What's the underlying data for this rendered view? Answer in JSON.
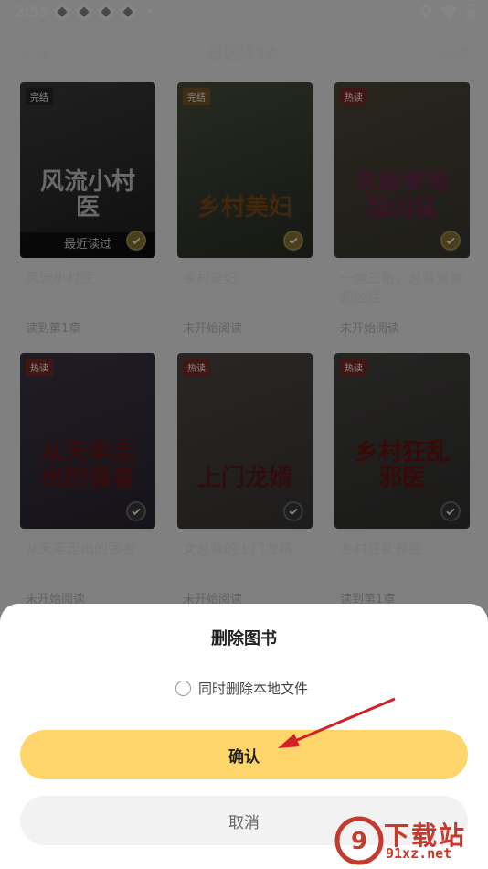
{
  "status": {
    "time": "2:55"
  },
  "header": {
    "select_all": "全选",
    "title": "已选择3本",
    "done": "完成"
  },
  "books": [
    {
      "tag": "完结",
      "cover_title": "风流小村医",
      "recent": "最近读过",
      "name": "风流小村医",
      "progress": "读到第1章",
      "bg1": "#3d3d3d",
      "bg2": "#1f1f1f",
      "tagcolor": "#2a2a2a",
      "titlecolor": "#c9c9c9",
      "check": "gold"
    },
    {
      "tag": "完结",
      "cover_title": "乡村美妇",
      "recent": "",
      "name": "乡村美妇",
      "progress": "未开始阅读",
      "bg1": "#4b5140",
      "bg2": "#2b3126",
      "tagcolor": "#7a5a2a",
      "titlecolor": "#7b4c19",
      "check": "gold"
    },
    {
      "tag": "热读",
      "cover_title": "总裁爹地超凶猛",
      "recent": "",
      "name": "一胞三胎，总裁爹爹超凶猛",
      "progress": "未开始阅读",
      "bg1": "#4d4838",
      "bg2": "#3b3a30",
      "tagcolor": "#7a2e2a",
      "titlecolor": "#6b2a4a",
      "check": "gold"
    },
    {
      "tag": "热读",
      "cover_title": "从天牢走出的强者",
      "recent": "",
      "name": "从天牢走出的强者",
      "progress": "未开始阅读",
      "bg1": "#3f3747",
      "bg2": "#2a2530",
      "tagcolor": "#7a2e2a",
      "titlecolor": "#6a1818",
      "check": "dark"
    },
    {
      "tag": "热读",
      "cover_title": "上门龙婿",
      "recent": "",
      "name": "女总裁的上门龙婿",
      "progress": "未开始阅读",
      "bg1": "#4f4a47",
      "bg2": "#3b3735",
      "tagcolor": "#7a2e2a",
      "titlecolor": "#5a1a1a",
      "check": "dark"
    },
    {
      "tag": "热读",
      "cover_title": "乡村狂乱邪医",
      "recent": "",
      "name": "乡村狂乱邪医",
      "progress": "读到第1章",
      "bg1": "#474644",
      "bg2": "#333230",
      "tagcolor": "#7a2e2a",
      "titlecolor": "#6a1515",
      "check": "dark"
    }
  ],
  "dialog": {
    "title": "删除图书",
    "option": "同时删除本地文件",
    "confirm": "确认",
    "cancel": "取消"
  },
  "watermark": {
    "text": "下载站",
    "url": "91xz.net"
  },
  "colors": {
    "accent": "#fdd56b",
    "arrow": "#d0202a"
  }
}
